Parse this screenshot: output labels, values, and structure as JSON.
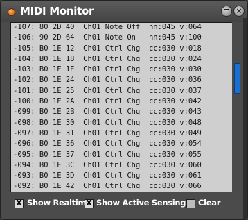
{
  "window": {
    "title": "MIDI Monitor",
    "minimize_glyph": "−",
    "close_glyph": "×"
  },
  "log": {
    "lines": [
      "-107: 80 2D 40  Ch01 Note Off  nn:045 v:064",
      "-106: 90 2D 64  Ch01 Note On   nn:045 v:100",
      "-105: B0 1E 12  Ch01 Ctrl Chg  cc:030 v:018",
      "-104: B0 1E 18  Ch01 Ctrl Chg  cc:030 v:024",
      "-103: B0 1E 1E  Ch01 Ctrl Chg  cc:030 v:030",
      "-102: B0 1E 24  Ch01 Ctrl Chg  cc:030 v:036",
      "-101: B0 1E 25  Ch01 Ctrl Chg  cc:030 v:037",
      "-100: B0 1E 2A  Ch01 Ctrl Chg  cc:030 v:042",
      "-099: B0 1E 2B  Ch01 Ctrl Chg  cc:030 v:043",
      "-098: B0 1E 30  Ch01 Ctrl Chg  cc:030 v:048",
      "-097: B0 1E 31  Ch01 Ctrl Chg  cc:030 v:049",
      "-096: B0 1E 36  Ch01 Ctrl Chg  cc:030 v:054",
      "-095: B0 1E 37  Ch01 Ctrl Chg  cc:030 v:055",
      "-094: B0 1E 3C  Ch01 Ctrl Chg  cc:030 v:060",
      "-093: B0 1E 3D  Ch01 Ctrl Chg  cc:030 v:061",
      "-092: B0 1E 42  Ch01 Ctrl Chg  cc:030 v:066"
    ]
  },
  "options": {
    "show_realtime": {
      "label": "Show Realtime",
      "checked": true,
      "mark": "X"
    },
    "show_active_sensing": {
      "label": "Show Active Sensing",
      "checked": true,
      "mark": "X"
    },
    "clear": {
      "label": "Clear"
    }
  },
  "colors": {
    "title_dot": "#e07a10",
    "scroll_thumb": "#1a6fd0",
    "log_background": "#cfcfcf",
    "window_background": "#4b4b4b"
  },
  "icons": {
    "title": "orange-dot-icon",
    "minimize": "minimize-icon",
    "close": "close-icon"
  }
}
